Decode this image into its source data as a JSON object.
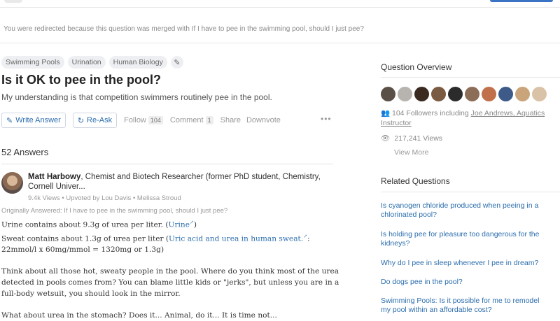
{
  "redirect_notice": "You were redirected because this question was merged with If I have to pee in the swimming pool, should I just pee?",
  "topics": [
    "Swimming Pools",
    "Urination",
    "Human Biology"
  ],
  "question": {
    "title": "Is it OK to pee in the pool?",
    "details": "My understanding is that competition swimmers routinely pee in the pool."
  },
  "actions": {
    "write_answer": "Write Answer",
    "reask": "Re-Ask",
    "follow": "Follow",
    "follow_count": "104",
    "comment": "Comment",
    "comment_count": "1",
    "share": "Share",
    "downvote": "Downvote",
    "more": "•••"
  },
  "answers_count": "52 Answers",
  "answer": {
    "author_name": "Matt Harbowy",
    "author_bio": ", Chemist and Biotech Researcher (former PhD student, Chemistry, Cornell Univer...",
    "meta": "9.4k Views • Upvoted by Lou Davis • Melissa Stroud",
    "originally_answered": "Originally Answered: If I have to pee in the swimming pool, should I just pee?",
    "line1_text": "Urine contains about 9.3g of urea per liter. (",
    "line1_link": "Urine",
    "line1_end": ")",
    "line2_text": "Sweat contains about 1.3g of urea per liter (",
    "line2_link": "Uric acid and urea in human sweat.",
    "line2_end": ":",
    "line3": "22mmol/l x 60mg/mmol = 1320mg or 1.3g)",
    "para2_l1": "Think about all those hot, sweaty people in the pool. Where do you think most of the urea",
    "para2_l2": "detected in pools comes from? You can blame little kids or \"jerks\", but unless you are in a",
    "para2_l3": "full-body wetsuit, you should look in the mirror.",
    "para3_l1": "What about urea in the stomach? Does it... Animal, do it... It is time not..."
  },
  "sidebar": {
    "overview_title": "Question Overview",
    "followers_text": "104 Followers including ",
    "follower_names": "Joe Andrews, Aquatics Instructor",
    "views": "217,241 Views",
    "view_more": "View More",
    "related_title": "Related Questions",
    "related": [
      "Is cyanogen chloride produced when peeing in a chlorinated pool?",
      "Is holding pee for pleasure too dangerous for the kidneys?",
      "Why do I pee in sleep whenever I pee in dream?",
      "Do dogs pee in the pool?",
      "Swimming Pools: Is it possible for me to remodel my pool within an affordable cost?"
    ]
  },
  "colors": {
    "link": "#2b6dad",
    "accent": "#3b74c4"
  }
}
